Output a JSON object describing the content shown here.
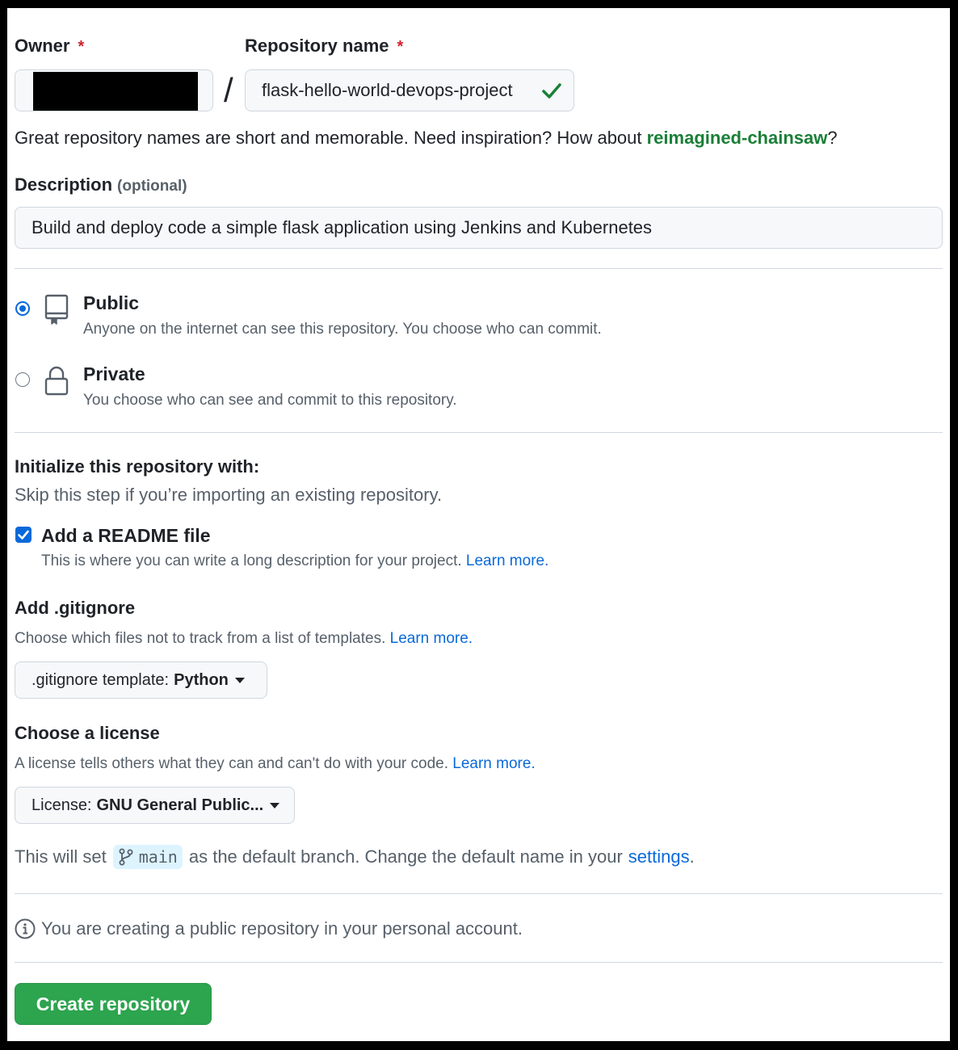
{
  "owner": {
    "label": "Owner",
    "required_mark": "*"
  },
  "repo": {
    "label": "Repository name",
    "required_mark": "*",
    "value": "flask-hello-world-devops-project",
    "separator": "/"
  },
  "name_hint": {
    "text": "Great repository names are short and memorable. Need inspiration? How about ",
    "suggestion": "reimagined-chainsaw",
    "end": "?"
  },
  "description": {
    "label": "Description",
    "optional": "(optional)",
    "value": "Build and deploy code a simple flask application using Jenkins and Kubernetes"
  },
  "visibility": {
    "public": {
      "title": "Public",
      "desc": "Anyone on the internet can see this repository. You choose who can commit.",
      "selected": true
    },
    "private": {
      "title": "Private",
      "desc": "You choose who can see and commit to this repository.",
      "selected": false
    }
  },
  "init": {
    "title": "Initialize this repository with:",
    "subtitle": "Skip this step if you’re importing an existing repository.",
    "readme": {
      "label": "Add a README file",
      "desc": "This is where you can write a long description for your project.",
      "link": "Learn more.",
      "checked": true
    }
  },
  "gitignore": {
    "title": "Add .gitignore",
    "desc": "Choose which files not to track from a list of templates.",
    "link": "Learn more.",
    "button_prefix": ".gitignore template:",
    "button_value": "Python"
  },
  "license": {
    "title": "Choose a license",
    "desc": "A license tells others what they can and can't do with your code.",
    "link": "Learn more.",
    "button_prefix": "License:",
    "button_value": "GNU General Public..."
  },
  "branch": {
    "text_before": "This will set",
    "branch_name": "main",
    "text_after": "as the default branch. Change the default name in your",
    "link": "settings",
    "end": "."
  },
  "info": {
    "text": "You are creating a public repository in your personal account."
  },
  "create_button": "Create repository",
  "icons": {
    "check": "check-icon",
    "repo": "repo-icon",
    "lock": "lock-icon",
    "branch": "git-branch-icon",
    "info": "info-icon"
  },
  "colors": {
    "accent_blue": "#0969da",
    "success_green": "#2da44e",
    "danger_red": "#cf222e"
  }
}
